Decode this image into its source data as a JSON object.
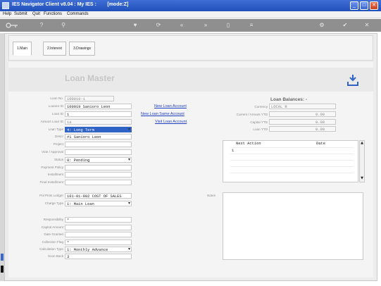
{
  "window": {
    "title": "IES Navigator Client v8.04 : My IES :        [mode:Z]",
    "minimize": "_",
    "maximize": "□",
    "close": "✕"
  },
  "menu": [
    "Help",
    "Submit",
    "Quit",
    "Functions",
    "Commands"
  ],
  "tabs": [
    {
      "label": "1.Main",
      "active": true
    },
    {
      "label": "2.Interest",
      "active": false
    },
    {
      "label": "3.Drawings",
      "active": false
    }
  ],
  "page_title": "Loan Master",
  "form": {
    "loan_no": {
      "label": "Loan No.",
      "value": "100019-1"
    },
    "loanee_id": {
      "label": "Loanee ID",
      "value": "100019 Saniorо Leon"
    },
    "loan_id": {
      "label": "Loan ID",
      "value": "1"
    },
    "arrears_loan_id": {
      "label": "Arrears Loan ID",
      "value": "1a"
    },
    "loan_type": {
      "label": "Loan Type",
      "value": "4: Long Term"
    },
    "descr": {
      "label": "Descr",
      "value": "#1 Saniorо Leon"
    },
    "project": {
      "label": "Project",
      "value": ""
    },
    "vote_approval": {
      "label": "Vote / Approval",
      "value": ""
    },
    "status": {
      "label": "Status",
      "value": "0: Pending"
    },
    "payment_policy": {
      "label": "Payment Policy",
      "value": ""
    },
    "installment": {
      "label": "Installment",
      "value": ""
    },
    "final_installment": {
      "label": "Final Installment",
      "value": ""
    },
    "pol_pmts_ledger": {
      "label": "Pol Pmts Ledger",
      "value": "101-01-002 COST OF SALES"
    },
    "charge_type": {
      "label": "Charge Type",
      "value": "1: Main Loan"
    },
    "responsibility": {
      "label": "Responsibility",
      "value": "*"
    },
    "capital_amount": {
      "label": "Capital Amount",
      "value": ""
    },
    "date_granted": {
      "label": "Date Granted",
      "value": ""
    },
    "collection_flag": {
      "label": "Collection Flag",
      "value": "*"
    },
    "calculation_type": {
      "label": "Calculation Type",
      "value": "1: Monthly Advance"
    },
    "scan_back": {
      "label": "Scan Back",
      "value": "3"
    }
  },
  "links": {
    "new_loan_account": "New Loan Account",
    "new_loan_same_account": "New Loan Same Account",
    "visit_loan_account": "Visit Loan Account"
  },
  "balances": {
    "heading": "Loan Balances: -",
    "currency": {
      "label": "Currency",
      "value": "LOCAL R"
    },
    "current_arrears_ytd": {
      "label": "Current / Arrears YTD",
      "value": "0.00"
    },
    "capital_ytd": {
      "label": "Capital YTD",
      "value": "0.00"
    },
    "loan_ytd": {
      "label": "Loan YTD",
      "value": "0.00"
    }
  },
  "actions_grid": {
    "columns": [
      "Next Action",
      "Date"
    ],
    "rows": [
      {
        "num": "1",
        "action": "",
        "date": ""
      }
    ]
  },
  "notes_label": "Notes",
  "colors": {
    "titlebar": "#1f4fb8",
    "toolbar": "#8f8f8f",
    "selected_field": "#2f63c6",
    "link": "#1f3fc0"
  }
}
